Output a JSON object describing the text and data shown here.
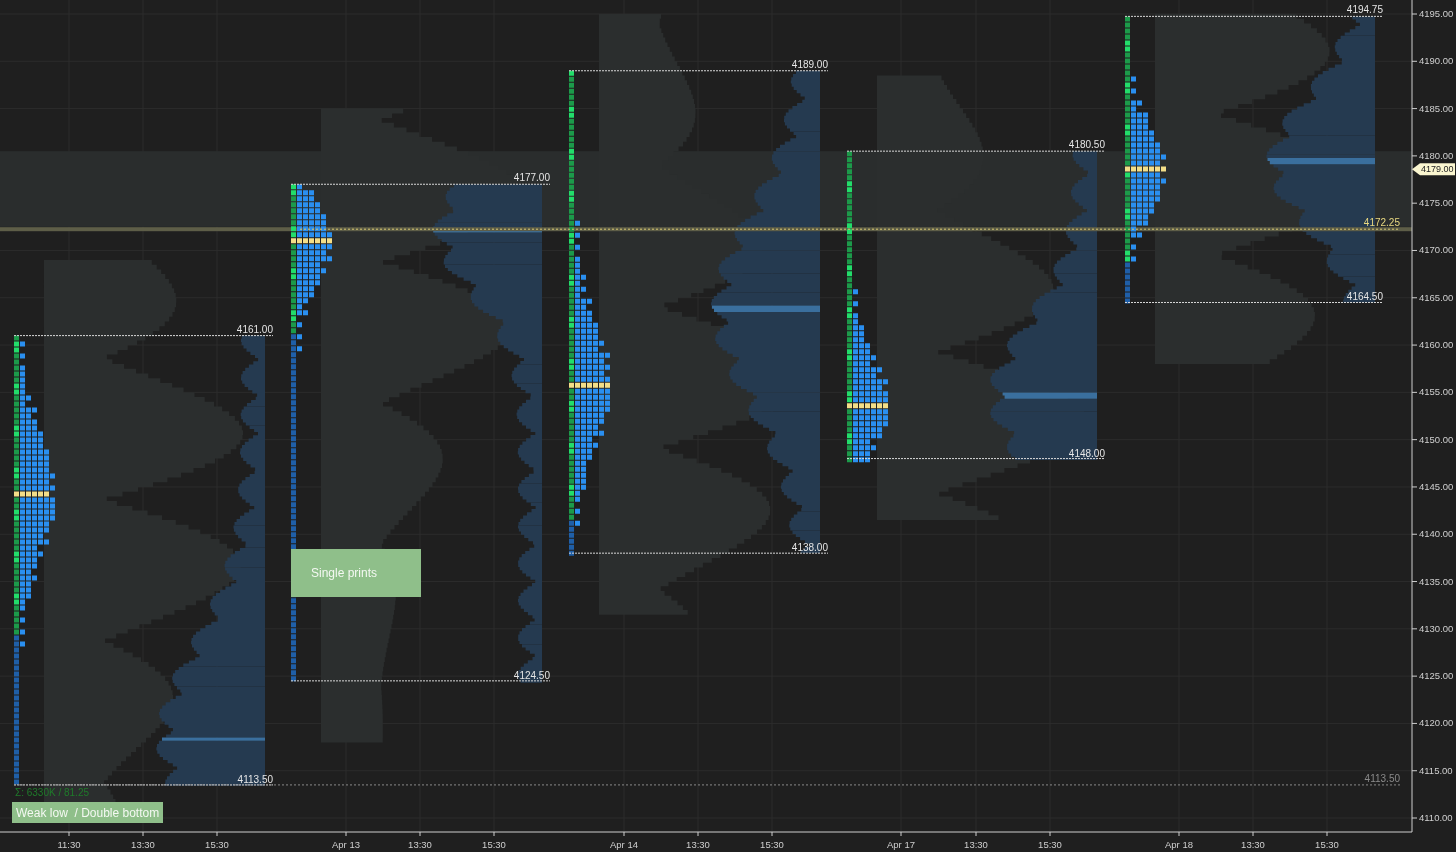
{
  "chart": {
    "y_axis": {
      "ticks": [
        "4195.00",
        "4190.00",
        "4185.00",
        "4180.00",
        "4175.00",
        "4170.00",
        "4165.00",
        "4160.00",
        "4155.00",
        "4150.00",
        "4145.00",
        "4140.00",
        "4135.00",
        "4130.00",
        "4125.00",
        "4120.00",
        "4115.00",
        "4110.00"
      ]
    },
    "x_axis": {
      "labels": [
        "11:30",
        "13:30",
        "15:30",
        "Apr 13",
        "13:30",
        "15:30",
        "Apr 14",
        "13:30",
        "15:30",
        "Apr 17",
        "13:30",
        "15:30",
        "Apr 18",
        "13:30",
        "15:30"
      ]
    },
    "sessions": [
      {
        "high_label": "4161.00",
        "low_label": "4113.50"
      },
      {
        "high_label": "4177.00",
        "low_label": "4124.50"
      },
      {
        "high_label": "4189.00",
        "low_label": "4138.00"
      },
      {
        "high_label": "4180.50",
        "low_label": "4148.00"
      },
      {
        "high_label": "4194.75",
        "low_label": "4164.50"
      }
    ],
    "extended_levels": [
      {
        "label": "4172.25",
        "kind": "poc"
      },
      {
        "label": "4113.50",
        "kind": "low"
      }
    ],
    "price_marker": {
      "label": "4179.00"
    },
    "summary": "Σ: 6330K / 81.25",
    "notes": [
      {
        "text": "Single prints"
      },
      {
        "text": "Weak low  / Double bottom"
      }
    ]
  }
}
